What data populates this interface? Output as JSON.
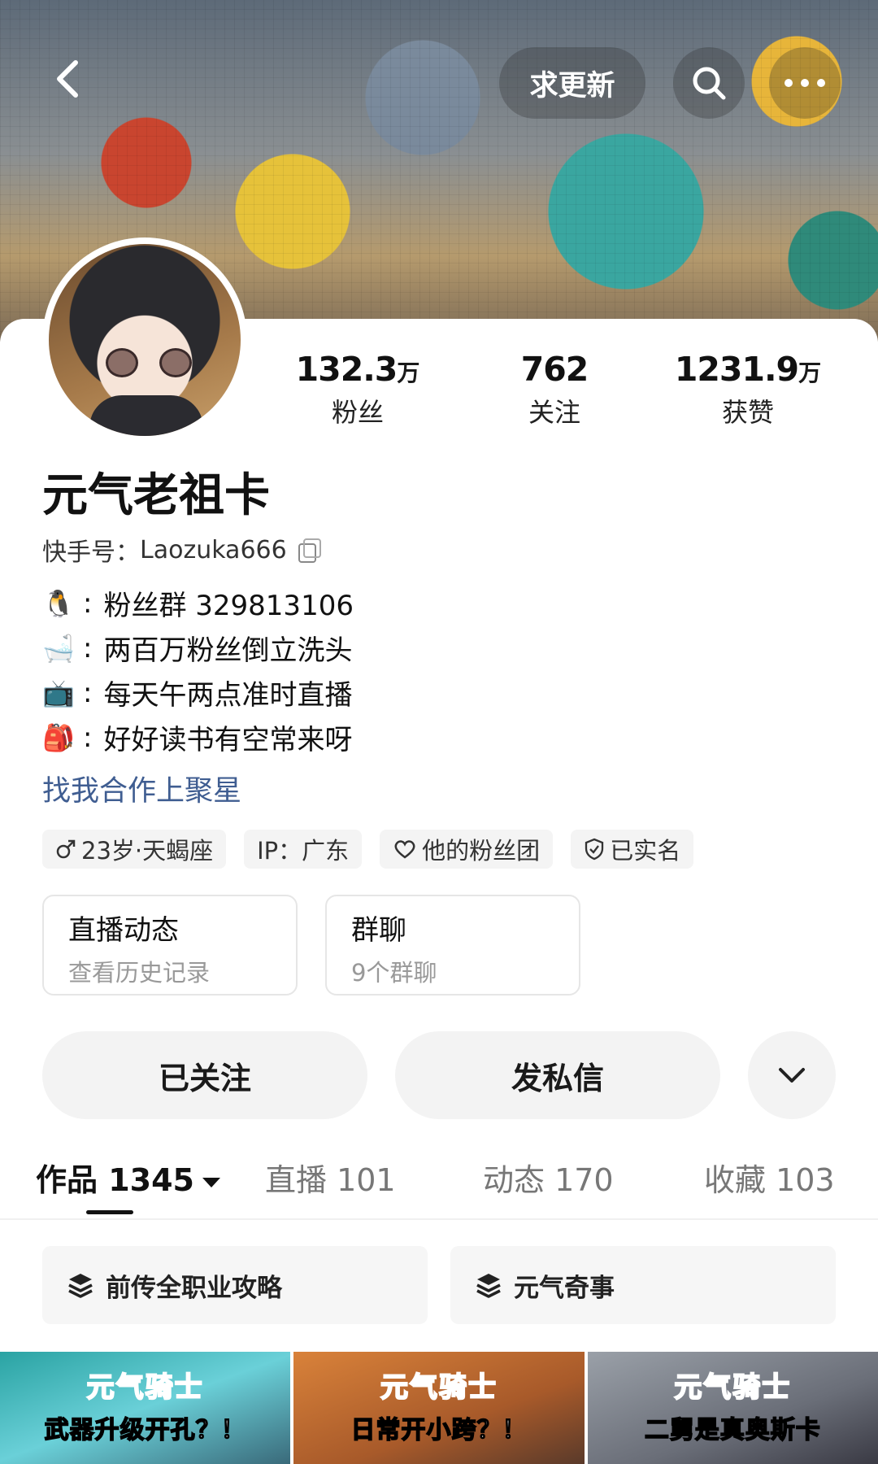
{
  "top_bar": {
    "update_label": "求更新"
  },
  "profile": {
    "name": "元气老祖卡",
    "kuaishou_id_label": "快手号：",
    "kuaishou_id": "Laozuka666"
  },
  "stats": {
    "fans": {
      "value": "132.3",
      "unit": "万",
      "label": "粉丝"
    },
    "following": {
      "value": "762",
      "unit": "",
      "label": "关注"
    },
    "likes": {
      "value": "1231.9",
      "unit": "万",
      "label": "获赞"
    }
  },
  "bio": [
    {
      "icon": "penguin-icon",
      "emoji": "🐧",
      "text": "粉丝群  329813106"
    },
    {
      "icon": "bathtub-icon",
      "emoji": "🛁",
      "text": "两百万粉丝倒立洗头"
    },
    {
      "icon": "tv-icon",
      "emoji": "📺",
      "text": "每天午两点准时直播"
    },
    {
      "icon": "backpack-icon",
      "emoji": "🎒",
      "text": "好好读书有空常来呀"
    }
  ],
  "collab_link": "找我合作上聚星",
  "tags": [
    {
      "icon": "male-icon",
      "label": "23岁·天蝎座"
    },
    {
      "icon": "",
      "label": "IP：广东"
    },
    {
      "icon": "heart-icon",
      "label": "他的粉丝团"
    },
    {
      "icon": "shield-check-icon",
      "label": "已实名"
    }
  ],
  "cards": [
    {
      "title": "直播动态",
      "subtitle": "查看历史记录"
    },
    {
      "title": "群聊",
      "subtitle": "9个群聊"
    }
  ],
  "actions": {
    "followed": "已关注",
    "message": "发私信"
  },
  "tabs": [
    {
      "label": "作品 1345",
      "active": true
    },
    {
      "label": "直播 101",
      "active": false
    },
    {
      "label": "动态 170",
      "active": false
    },
    {
      "label": "收藏 103",
      "active": false
    }
  ],
  "collections": [
    {
      "label": "前传全职业攻略"
    },
    {
      "label": "元气奇事"
    }
  ],
  "thumbnails": [
    {
      "brand": "元气骑士",
      "caption": "武器升级开孔？！"
    },
    {
      "brand": "元气骑士",
      "caption": "日常开小跨？！"
    },
    {
      "brand": "元气骑士",
      "caption": "二舅是真奥斯卡"
    }
  ],
  "colors": {
    "link": "#3f5d91",
    "chip_bg": "#f4f4f4",
    "button_bg": "#f3f3f3"
  }
}
